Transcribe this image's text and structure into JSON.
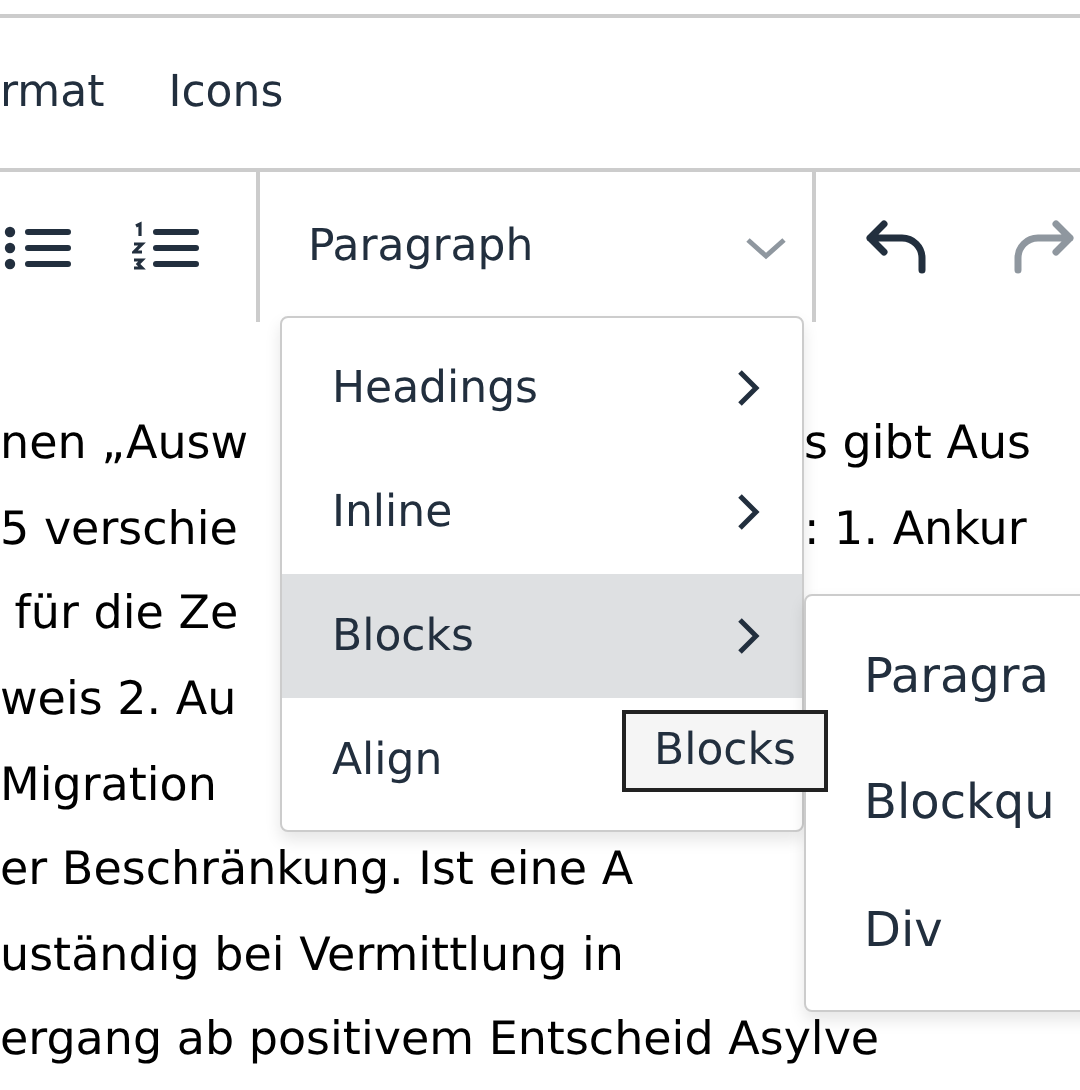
{
  "menubar": [
    {
      "label": "rmat"
    },
    {
      "label": "Icons"
    }
  ],
  "toolbar": {
    "lists": [
      {
        "kind": "bullet"
      },
      {
        "kind": "numbered"
      }
    ],
    "block_select": "Paragraph",
    "history": [
      {
        "kind": "undo",
        "disabled": false
      },
      {
        "kind": "redo",
        "disabled": true
      }
    ]
  },
  "body_lines": [
    {
      "left": "nen „Ausw",
      "right": "s gibt Aus"
    },
    {
      "left": "5 verschie",
      "right": ": 1. Ankur"
    },
    {
      "left": " für die Ze"
    },
    {
      "left": "weis 2. Au"
    },
    {
      "left": "Migration"
    },
    {
      "left": "er Beschränkung. Ist eine A"
    },
    {
      "left": "uständig bei Vermittlung in"
    },
    {
      "left": "ergang ab positivem Entscheid Asylve"
    }
  ],
  "format_menu": {
    "items": [
      {
        "label": "Headings",
        "selected": false,
        "arrow": true
      },
      {
        "label": "Inline",
        "selected": false,
        "arrow": true
      },
      {
        "label": "Blocks",
        "selected": true,
        "arrow": true
      },
      {
        "label": "Align",
        "selected": false
      }
    ]
  },
  "submenu": {
    "items": [
      {
        "label": "Paragra"
      },
      {
        "label": "Blockqu"
      },
      {
        "label": "Div"
      }
    ]
  },
  "tooltip": "Blocks"
}
